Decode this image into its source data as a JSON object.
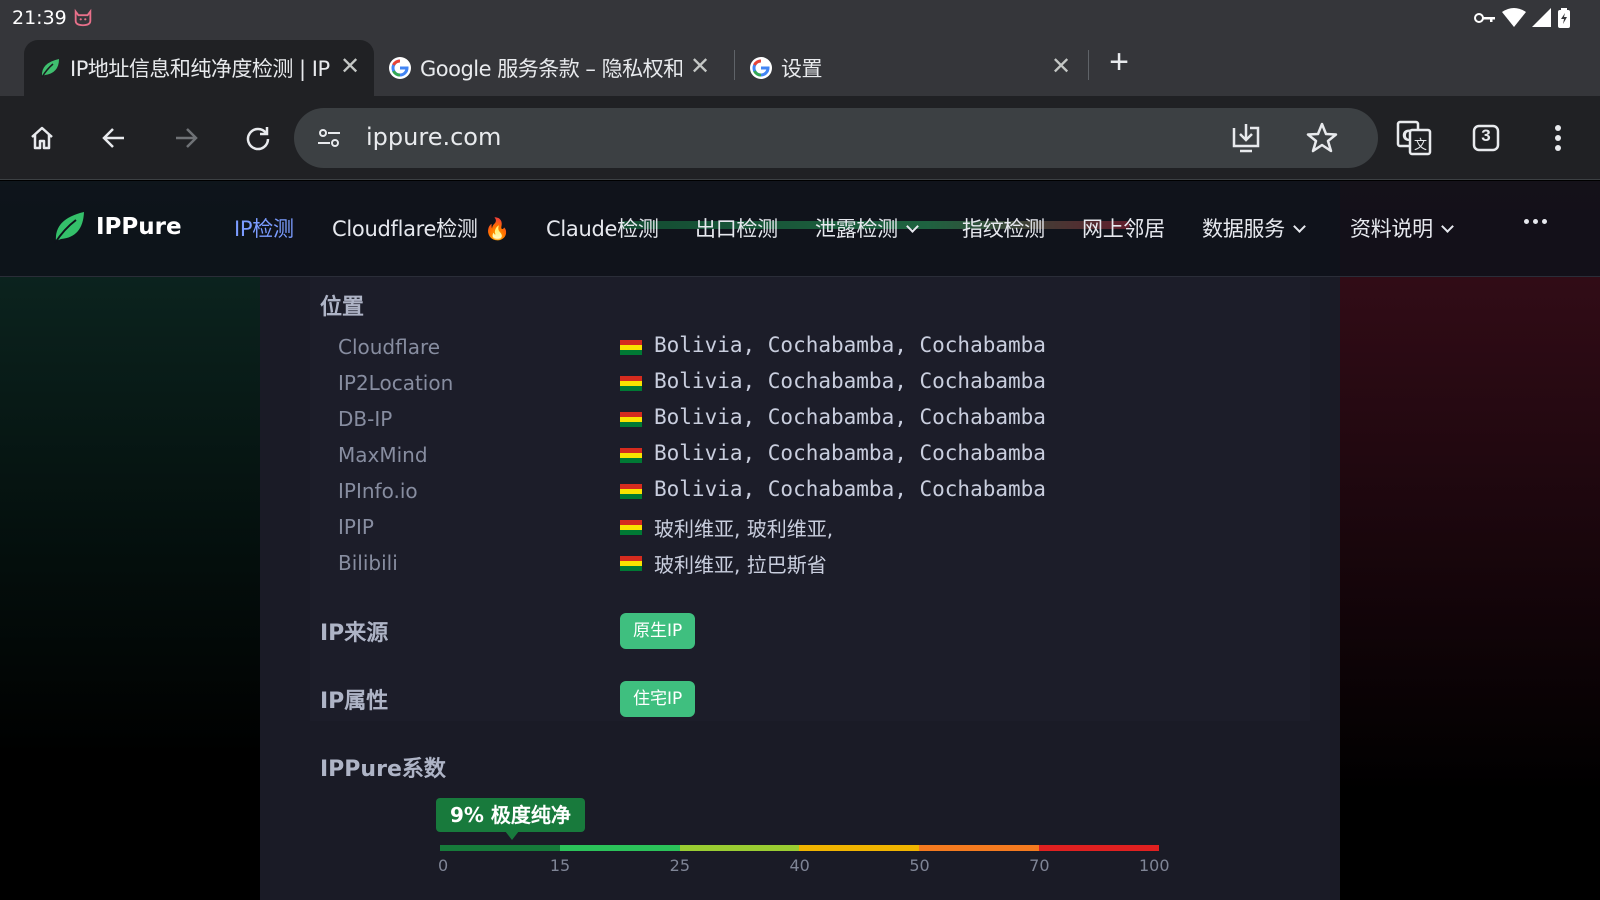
{
  "status_bar": {
    "time": "21:39"
  },
  "tabs": [
    {
      "title": "IP地址信息和纯净度检测 | IP",
      "active": true,
      "favicon": "leaf-icon"
    },
    {
      "title": "Google 服务条款 – 隐私权和",
      "active": false,
      "favicon": "google-g-icon"
    },
    {
      "title": "设置",
      "active": false,
      "favicon": "google-g-icon"
    }
  ],
  "toolbar": {
    "url": "ippure.com",
    "tab_count": "3"
  },
  "site": {
    "logo_text": "IPPure",
    "nav": [
      {
        "label": "IP检测",
        "active": true
      },
      {
        "label": "Cloudflare检测 🔥"
      },
      {
        "label": "Claude检测"
      },
      {
        "label": "出口检测"
      },
      {
        "label": "泄露检测"
      },
      {
        "label": "指纹检测"
      },
      {
        "label": "网上邻居"
      },
      {
        "label": "数据服务"
      },
      {
        "label": "资料说明"
      }
    ]
  },
  "location": {
    "title": "位置",
    "rows": [
      {
        "source": "Cloudflare",
        "value": "Bolivia, Cochabamba, Cochabamba"
      },
      {
        "source": "IP2Location",
        "value": "Bolivia, Cochabamba, Cochabamba"
      },
      {
        "source": "DB-IP",
        "value": "Bolivia, Cochabamba, Cochabamba"
      },
      {
        "source": "MaxMind",
        "value": "Bolivia, Cochabamba, Cochabamba"
      },
      {
        "source": "IPInfo.io",
        "value": "Bolivia, Cochabamba, Cochabamba"
      },
      {
        "source": "IPIP",
        "value": "玻利维亚, 玻利维亚,"
      },
      {
        "source": "Bilibili",
        "value": "玻利维亚, 拉巴斯省"
      }
    ]
  },
  "ip_source": {
    "title": "IP来源",
    "badge": "原生IP"
  },
  "ip_attr": {
    "title": "IP属性",
    "badge": "住宅IP"
  },
  "score": {
    "title": "IPPure系数",
    "badge": "9% 极度纯净",
    "value_percent": 9,
    "ticks": [
      "0",
      "15",
      "25",
      "40",
      "50",
      "70",
      "100"
    ],
    "segment_colors": [
      "#167a3a",
      "#2bc35a",
      "#9acd32",
      "#f0b400",
      "#f47a1f",
      "#e02020"
    ]
  }
}
